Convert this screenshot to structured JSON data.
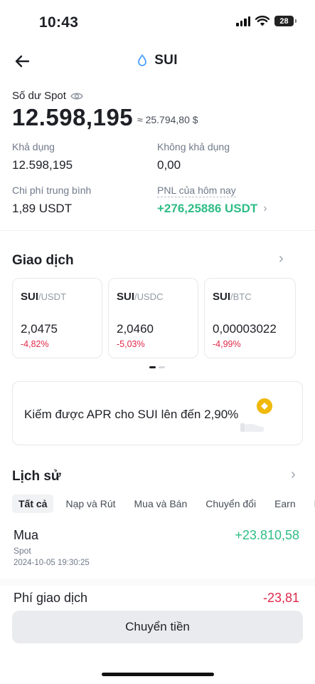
{
  "status_bar": {
    "time": "10:43",
    "battery": "28"
  },
  "header": {
    "title": "SUI"
  },
  "balance": {
    "label": "Số dư Spot",
    "amount": "12.598,195",
    "fiat": "≈ 25.794,80 $",
    "available_label": "Khả dụng",
    "available_value": "12.598,195",
    "unavailable_label": "Không khả dụng",
    "unavailable_value": "0,00",
    "avg_cost_label": "Chi phí trung bình",
    "avg_cost_value": "1,89 USDT",
    "pnl_label": "PNL của hôm nay",
    "pnl_value": "+276,25886  USDT"
  },
  "trade": {
    "title": "Giao dịch",
    "pairs": [
      {
        "base": "SUI",
        "quote": "/USDT",
        "price": "2,0475",
        "change": "-4,82%"
      },
      {
        "base": "SUI",
        "quote": "/USDC",
        "price": "2,0460",
        "change": "-5,03%"
      },
      {
        "base": "SUI",
        "quote": "/BTC",
        "price": "0,00003022",
        "change": "-4,99%"
      }
    ]
  },
  "promo": {
    "text": "Kiếm được APR cho SUI lên đến 2,90%"
  },
  "history": {
    "title": "Lịch sử",
    "filters": [
      "Tất cả",
      "Nạp và Rút",
      "Mua và Bán",
      "Chuyển đổi",
      "Earn",
      "P"
    ],
    "entry": {
      "type": "Mua",
      "account": "Spot",
      "datetime": "2024-10-05 19:30:25",
      "amount": "+23.810,58"
    },
    "fee": {
      "label": "Phí giao dịch",
      "amount": "-23,81"
    }
  },
  "actions": {
    "transfer_label": "Chuyển tiền"
  },
  "colors": {
    "positive": "#2ebd85",
    "negative": "#e0294a",
    "brand": "#f0b90b"
  }
}
